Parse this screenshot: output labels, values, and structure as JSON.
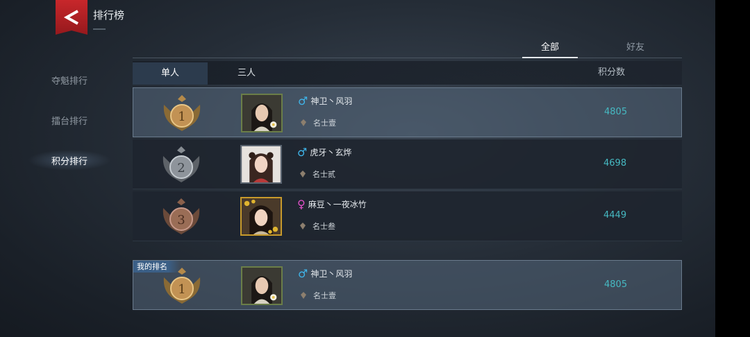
{
  "header": {
    "title": "排行榜"
  },
  "sidebar": {
    "items": [
      {
        "label": "夺魁排行",
        "active": false
      },
      {
        "label": "擂台排行",
        "active": false
      },
      {
        "label": "积分排行",
        "active": true
      }
    ]
  },
  "top_tabs": [
    {
      "label": "全部",
      "active": true
    },
    {
      "label": "好友",
      "active": false
    }
  ],
  "sub_tabs": [
    {
      "label": "单人",
      "active": true
    },
    {
      "label": "三人",
      "active": false
    }
  ],
  "score_header": "积分数",
  "rows": [
    {
      "rank": "1",
      "medal": "gold-medal",
      "gender": "♂",
      "gender_type": "male",
      "name": "神卫丶风羽",
      "title": "名士壹",
      "score": "4805"
    },
    {
      "rank": "2",
      "medal": "silver-medal",
      "gender": "♂",
      "gender_type": "male",
      "name": "虎牙丶玄烨",
      "title": "名士贰",
      "score": "4698"
    },
    {
      "rank": "3",
      "medal": "bronze-medal",
      "gender": "♀",
      "gender_type": "female",
      "name": "麻豆丶一夜冰竹",
      "title": "名士叁",
      "score": "4449"
    }
  ],
  "my_rank": {
    "tag": "我的排名",
    "rank": "1",
    "gender": "♂",
    "name": "神卫丶风羽",
    "title": "名士壹",
    "score": "4805"
  },
  "colors": {
    "accent_red": "#c8272b",
    "score": "#46b9c2",
    "male": "#3fb5ea",
    "female": "#de4fc6"
  }
}
